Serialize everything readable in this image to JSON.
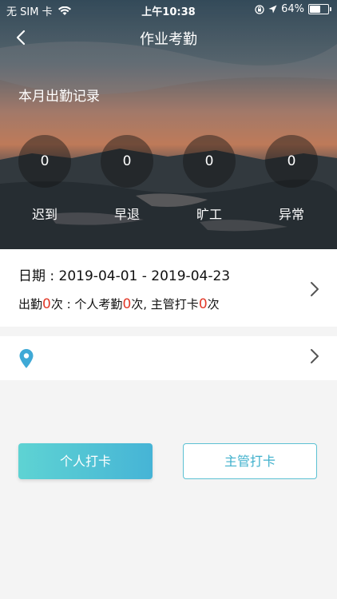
{
  "status_bar": {
    "carrier": "无 SIM 卡",
    "time": "上午10:38",
    "battery": "64%",
    "battery_level": 0.64
  },
  "nav": {
    "title": "作业考勤"
  },
  "hero": {
    "month_label": "本月出勤记录",
    "stats": [
      {
        "value": "0",
        "label": "迟到"
      },
      {
        "value": "0",
        "label": "早退"
      },
      {
        "value": "0",
        "label": "旷工"
      },
      {
        "value": "0",
        "label": "异常"
      }
    ]
  },
  "date_card": {
    "date_prefix": "日期 : ",
    "start_date": "2019-04-01",
    "separator": " - ",
    "end_date": "2019-04-23",
    "attendance_label": "出勤",
    "attendance_count": "0",
    "attendance_unit": "次 : 个人考勤",
    "personal_count": "0",
    "personal_unit": "次, 主管打卡",
    "manager_count": "0",
    "manager_unit": "次"
  },
  "buttons": {
    "personal": "个人打卡",
    "manager": "主管打卡"
  },
  "colors": {
    "accent": "#46b4d6",
    "highlight_red": "#e23a2a",
    "pin": "#3fa9d6"
  }
}
